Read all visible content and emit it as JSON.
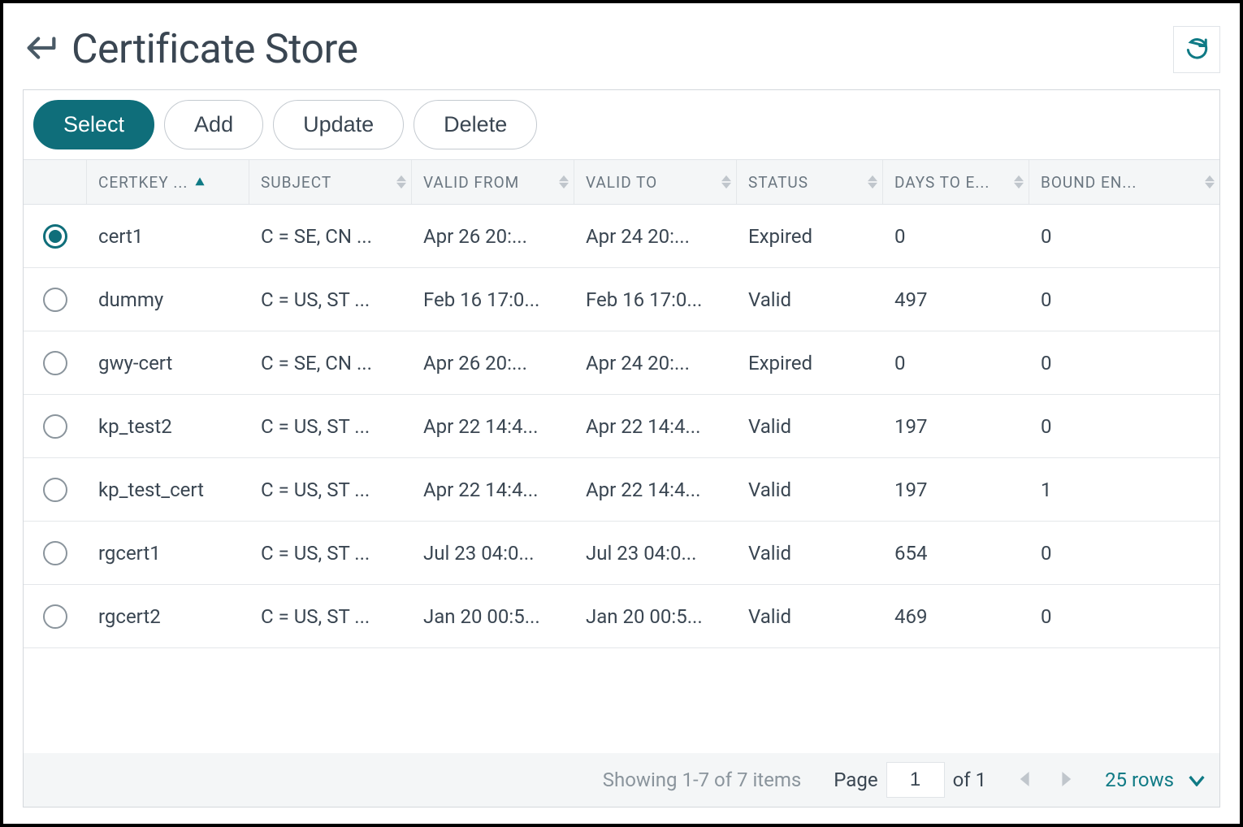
{
  "header": {
    "title": "Certificate Store"
  },
  "toolbar": {
    "select": "Select",
    "add": "Add",
    "update": "Update",
    "delete": "Delete"
  },
  "columns": {
    "certkey": "CERTKEY ...",
    "subject": "SUBJECT",
    "valid_from": "VALID FROM",
    "valid_to": "VALID TO",
    "status": "STATUS",
    "days": "DAYS TO E...",
    "bound": "BOUND EN..."
  },
  "rows": [
    {
      "selected": true,
      "certkey": "cert1",
      "subject": "C = SE, CN ...",
      "valid_from": "Apr 26 20:...",
      "valid_to": "Apr 24 20:...",
      "status": "Expired",
      "days": "0",
      "bound": "0"
    },
    {
      "selected": false,
      "certkey": "dummy",
      "subject": "C = US, ST ...",
      "valid_from": "Feb 16 17:0...",
      "valid_to": "Feb 16 17:0...",
      "status": "Valid",
      "days": "497",
      "bound": "0"
    },
    {
      "selected": false,
      "certkey": "gwy-cert",
      "subject": "C = SE, CN ...",
      "valid_from": "Apr 26 20:...",
      "valid_to": "Apr 24 20:...",
      "status": "Expired",
      "days": "0",
      "bound": "0"
    },
    {
      "selected": false,
      "certkey": "kp_test2",
      "subject": "C = US, ST ...",
      "valid_from": "Apr 22 14:4...",
      "valid_to": "Apr 22 14:4...",
      "status": "Valid",
      "days": "197",
      "bound": "0"
    },
    {
      "selected": false,
      "certkey": "kp_test_cert",
      "subject": "C = US, ST ...",
      "valid_from": "Apr 22 14:4...",
      "valid_to": "Apr 22 14:4...",
      "status": "Valid",
      "days": "197",
      "bound": "1"
    },
    {
      "selected": false,
      "certkey": "rgcert1",
      "subject": "C = US, ST ...",
      "valid_from": "Jul 23 04:0...",
      "valid_to": "Jul 23 04:0...",
      "status": "Valid",
      "days": "654",
      "bound": "0"
    },
    {
      "selected": false,
      "certkey": "rgcert2",
      "subject": "C = US, ST ...",
      "valid_from": "Jan 20 00:5...",
      "valid_to": "Jan 20 00:5...",
      "status": "Valid",
      "days": "469",
      "bound": "0"
    }
  ],
  "footer": {
    "summary": "Showing 1-7 of 7 items",
    "page_label": "Page",
    "page_value": "1",
    "page_total": "of 1",
    "rows_label": "25 rows"
  }
}
